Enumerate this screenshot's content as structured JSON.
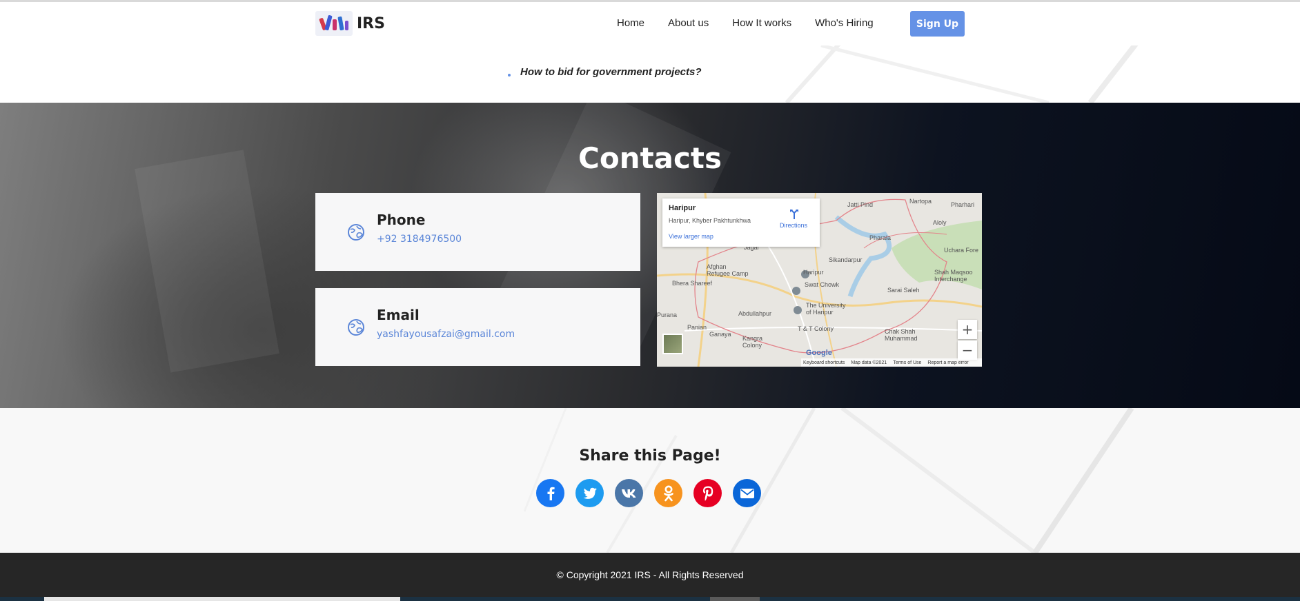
{
  "header": {
    "logo_text": "IRS",
    "nav": [
      "Home",
      "About us",
      "How It works",
      "Who's Hiring"
    ],
    "signup_label": "Sign Up"
  },
  "faq": {
    "item": "How to bid for government projects?"
  },
  "contacts": {
    "title": "Contacts",
    "phone": {
      "label": "Phone",
      "value": "+92 3184976500",
      "icon": "globe-icon"
    },
    "email": {
      "label": "Email",
      "value": "yashfayousafzai@gmail.com",
      "icon": "globe-icon"
    }
  },
  "map": {
    "place_name": "Haripur",
    "place_address": "Haripur, Khyber Pakhtunkhwa",
    "directions_label": "Directions",
    "larger_map_link": "View larger map",
    "zoom_in": "+",
    "zoom_out": "−",
    "brand": "Google",
    "footer": [
      "Keyboard shortcuts",
      "Map data ©2021",
      "Terms of Use",
      "Report a map error"
    ],
    "labels": {
      "jatti_pind": "Jatti Pind",
      "nartopa": "Nartopa",
      "pharhari": "Pharhari",
      "aloly": "Aloly",
      "uchara_fore": "Uchara Fore",
      "pharala": "Pharala",
      "jagai": "Jagai",
      "sikandarpur": "Sikandarpur",
      "afghan_refugee_camp": "Afghan\nRefugee Camp",
      "haripur": "Haripur",
      "shah_maqsood": "Shah Maqsoo\nInterchange",
      "bhera_shareef": "Bhera Shareef",
      "swat_chowk": "Swat Chowk",
      "sarai_saleh": "Sarai Saleh",
      "university": "The University\nof Haripur",
      "abdullahpur": "Abdullahpur",
      "purana": "Purana",
      "panian": "Panian",
      "ganaya": "Ganaya",
      "t_t_colony": "T & T Colony",
      "chak_shah": "Chak Shah\nMuhammad",
      "kangra": "Kangra\nColony"
    }
  },
  "share": {
    "title": "Share this Page!",
    "icons": [
      {
        "name": "facebook-icon",
        "color": "#1877f2"
      },
      {
        "name": "twitter-icon",
        "color": "#1d9bf0"
      },
      {
        "name": "vk-icon",
        "color": "#4a76a8"
      },
      {
        "name": "odnoklassniki-icon",
        "color": "#f7931e"
      },
      {
        "name": "pinterest-icon",
        "color": "#e60023"
      },
      {
        "name": "mail-icon",
        "color": "#0a66d8"
      }
    ]
  },
  "footer": {
    "copyright": "© Copyright 2021 IRS - All Rights Reserved"
  }
}
